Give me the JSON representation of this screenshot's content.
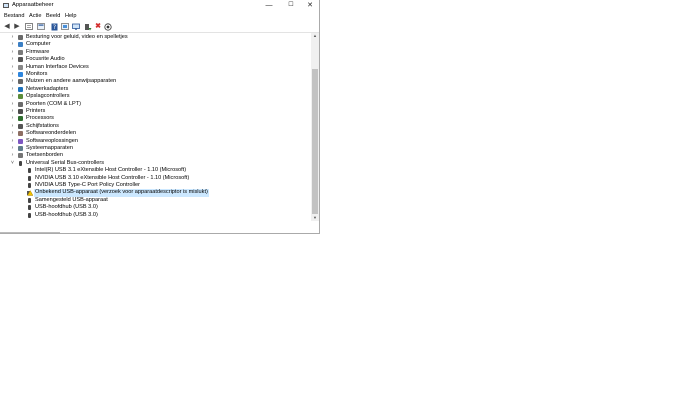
{
  "window": {
    "title": "Apparaatbeheer",
    "controls": {
      "minimize": "—",
      "maximize": "☐",
      "close": "✕"
    }
  },
  "menu": [
    "Bestand",
    "Actie",
    "Beeld",
    "Help"
  ],
  "toolbar": {
    "icons": [
      "back-arrow-icon",
      "forward-arrow-icon",
      "properties-icon",
      "refresh-icon",
      "help-icon",
      "display-devices-icon",
      "update-driver-icon",
      "disable-device-icon",
      "uninstall-device-icon",
      "scan-hardware-icon"
    ],
    "colors": {
      "accent": "#2b579a",
      "uninstall_red": "#d32f2f",
      "selection": "#cce8ff"
    }
  },
  "tree": {
    "categories": [
      {
        "label": "Besturing voor geluid, video en spelletjes",
        "icon": "sound-icon"
      },
      {
        "label": "Computer",
        "icon": "computer-icon"
      },
      {
        "label": "Firmware",
        "icon": "firmware-icon"
      },
      {
        "label": "Focusrite Audio",
        "icon": "audio-icon"
      },
      {
        "label": "Human Interface Devices",
        "icon": "hid-icon"
      },
      {
        "label": "Monitors",
        "icon": "monitor-icon"
      },
      {
        "label": "Muizen en andere aanwijsapparaten",
        "icon": "mouse-icon"
      },
      {
        "label": "Netwerkadapters",
        "icon": "network-icon"
      },
      {
        "label": "Opslagcontrollers",
        "icon": "storage-icon"
      },
      {
        "label": "Poorten (COM & LPT)",
        "icon": "port-icon"
      },
      {
        "label": "Printers",
        "icon": "printer-icon"
      },
      {
        "label": "Processors",
        "icon": "processor-icon"
      },
      {
        "label": "Schijfstations",
        "icon": "disk-icon"
      },
      {
        "label": "Softwareonderdelen",
        "icon": "software-component-icon"
      },
      {
        "label": "Softwareoplossingen",
        "icon": "software-solution-icon"
      },
      {
        "label": "Systeemapparaten",
        "icon": "system-device-icon"
      },
      {
        "label": "Toetsenborden",
        "icon": "keyboard-icon"
      }
    ],
    "expanded": {
      "label": "Universal Serial Bus-controllers",
      "children": [
        {
          "label": "Intel(R) USB 3.1 eXtensible Host Controller - 1.10 (Microsoft)",
          "warning": false
        },
        {
          "label": "NVIDIA USB 3.10 eXtensible Host Controller - 1.10 (Microsoft)",
          "warning": false
        },
        {
          "label": "NVIDIA USB Type-C Port Policy Controller",
          "warning": false
        },
        {
          "label": "Onbekend USB-apparaat (verzoek voor apparaatdescriptor is mislukt)",
          "warning": true
        },
        {
          "label": "Samengesteld USB-apparaat",
          "warning": false
        },
        {
          "label": "USB-hoofdhub (USB 3.0)",
          "warning": false
        },
        {
          "label": "USB-hoofdhub (USB 3.0)",
          "warning": false
        }
      ]
    }
  }
}
